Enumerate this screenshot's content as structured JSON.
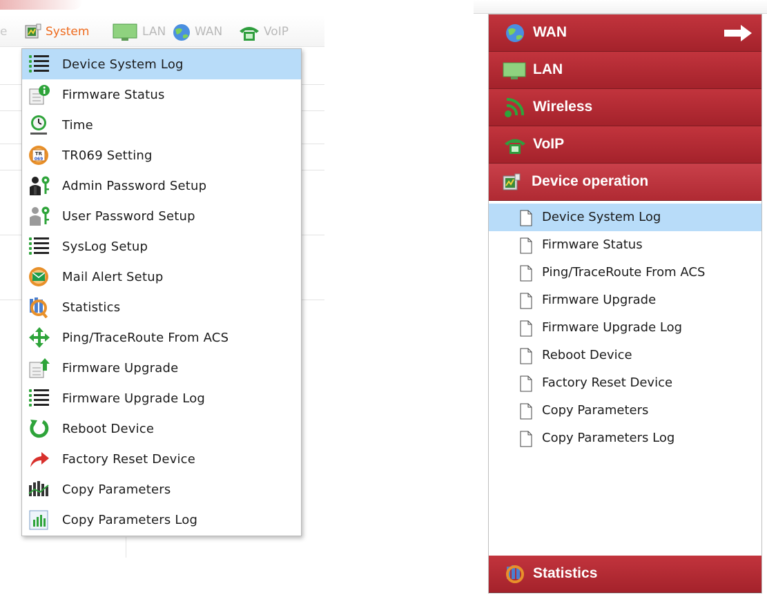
{
  "colors": {
    "accent_orange": "#ee6a1d",
    "selection_blue": "#b8dcf9",
    "section_red": "#b42a33",
    "icon_green": "#2ea43a"
  },
  "top_nav": {
    "tabs": [
      {
        "label": "System",
        "icon": "device-chip-icon",
        "active": true
      },
      {
        "label": "LAN",
        "icon": "monitor-icon",
        "active": false
      },
      {
        "label": "WAN",
        "icon": "globe-icon",
        "active": false
      },
      {
        "label": "VoIP",
        "icon": "phone-icon",
        "active": false
      }
    ]
  },
  "dropdown": {
    "items": [
      {
        "label": "Device System Log",
        "icon": "list-icon",
        "selected": true
      },
      {
        "label": "Firmware Status",
        "icon": "info-document-icon",
        "selected": false
      },
      {
        "label": "Time",
        "icon": "clock-icon",
        "selected": false
      },
      {
        "label": "TR069 Setting",
        "icon": "tr069-gear-icon",
        "selected": false
      },
      {
        "label": "Admin Password Setup",
        "icon": "admin-key-icon",
        "selected": false
      },
      {
        "label": "User Password Setup",
        "icon": "user-key-icon",
        "selected": false
      },
      {
        "label": "SysLog Setup",
        "icon": "list-icon",
        "selected": false
      },
      {
        "label": "Mail Alert Setup",
        "icon": "mail-gear-icon",
        "selected": false
      },
      {
        "label": "Statistics",
        "icon": "statistics-magnifier-icon",
        "selected": false
      },
      {
        "label": "Ping/TraceRoute From ACS",
        "icon": "move-arrows-icon",
        "selected": false
      },
      {
        "label": "Firmware Upgrade",
        "icon": "upload-document-icon",
        "selected": false
      },
      {
        "label": "Firmware Upgrade Log",
        "icon": "list-icon",
        "selected": false
      },
      {
        "label": "Reboot Device",
        "icon": "reboot-arrow-icon",
        "selected": false
      },
      {
        "label": "Factory Reset Device",
        "icon": "reset-arrow-icon",
        "selected": false
      },
      {
        "label": "Copy Parameters",
        "icon": "bars-icon",
        "selected": false
      },
      {
        "label": "Copy Parameters Log",
        "icon": "bars-document-icon",
        "selected": false
      }
    ]
  },
  "sidebar": {
    "sections": [
      {
        "title": "WAN",
        "icon": "globe-icon",
        "has_arrow": true
      },
      {
        "title": "LAN",
        "icon": "monitor-icon"
      },
      {
        "title": "Wireless",
        "icon": "wireless-icon"
      },
      {
        "title": "VoIP",
        "icon": "phone-icon"
      },
      {
        "title": "Device operation",
        "icon": "device-chip-icon",
        "expanded": true
      }
    ],
    "device_operation_items": [
      {
        "label": "Device System Log",
        "selected": true
      },
      {
        "label": "Firmware Status",
        "selected": false
      },
      {
        "label": "Ping/TraceRoute From ACS",
        "selected": false
      },
      {
        "label": "Firmware Upgrade",
        "selected": false
      },
      {
        "label": "Firmware Upgrade Log",
        "selected": false
      },
      {
        "label": "Reboot Device",
        "selected": false
      },
      {
        "label": "Factory Reset Device",
        "selected": false
      },
      {
        "label": "Copy Parameters",
        "selected": false
      },
      {
        "label": "Copy Parameters Log",
        "selected": false
      }
    ],
    "bottom_section": {
      "title": "Statistics",
      "icon": "statistics-magnifier-icon"
    }
  }
}
